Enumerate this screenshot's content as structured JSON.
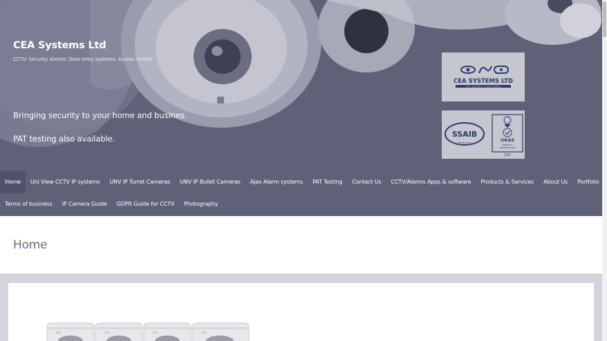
{
  "site": {
    "title": "CEA Systems Ltd",
    "description": "CCTV: Security Alarms: Door entry systems: Access control."
  },
  "hero": {
    "tagline1": "Bringing security to your home and busines.",
    "tagline2": "PAT testing also available."
  },
  "badges": {
    "company_logo_text": "CEA SYSTEMS LTD",
    "company_logo_sub": "CCTV · ELECTRICAL · ACCESS CONTROL",
    "ssaib_text": "SSAIB",
    "ssaib_sub": "CERTIFICATED",
    "ukas_text": "UKAS",
    "ukas_sub1": "PRODUCT",
    "ukas_sub2": "CERTIFICATION",
    "ukas_number": "131"
  },
  "nav": {
    "row1": [
      {
        "label": "Home",
        "active": true
      },
      {
        "label": "Uni View CCTV IP systems"
      },
      {
        "label": "UNV IP Turret Cameras"
      },
      {
        "label": "UNV IP Bullet Cameras"
      },
      {
        "label": "Ajax Alarm systems"
      },
      {
        "label": "PAT Testing"
      },
      {
        "label": "Contact Us"
      },
      {
        "label": "CCTV/Alarms Apps & software"
      },
      {
        "label": "Products & Services"
      },
      {
        "label": "About Us"
      },
      {
        "label": "Portfolio"
      }
    ],
    "row2": [
      {
        "label": "Terms of business"
      },
      {
        "label": "IP Camera Guide"
      },
      {
        "label": "GDPR Guide for CCTV"
      },
      {
        "label": "Photography"
      }
    ]
  },
  "page": {
    "title": "Home"
  },
  "product_labels": [
    "unv",
    "unv",
    "unv",
    "unv"
  ],
  "colors": {
    "header_bg": "#5f6178",
    "nav_active_bg": "#50526a",
    "title_color": "#6a6b7e",
    "page_bg": "#d4d4de"
  }
}
